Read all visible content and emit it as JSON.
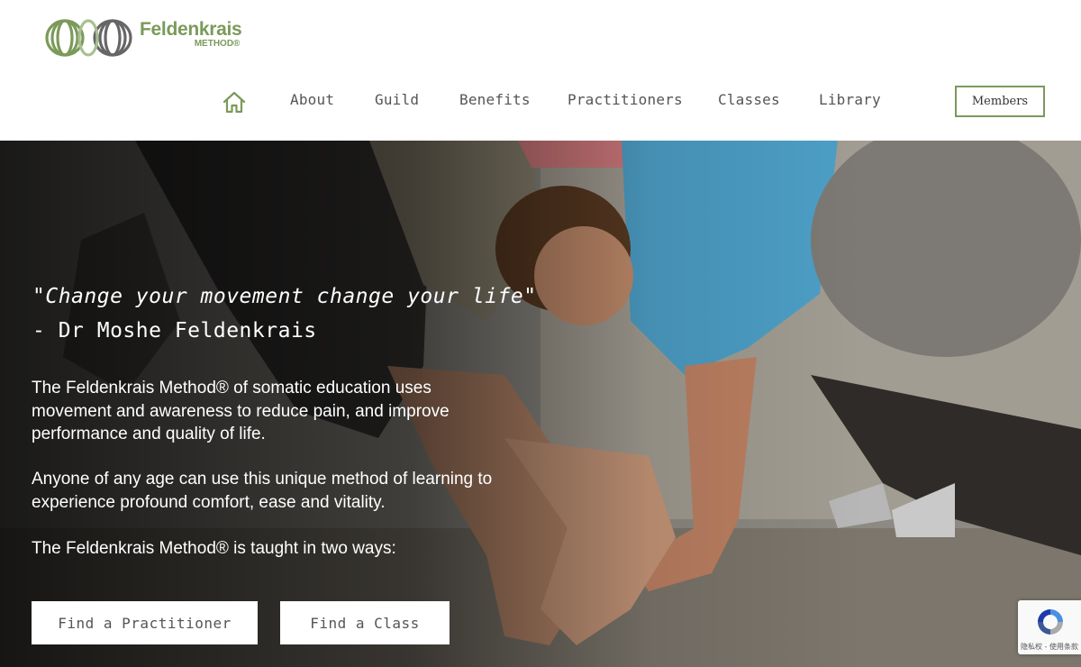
{
  "brand": {
    "name": "Feldenkrais",
    "sub": "METHOD®",
    "color": "#7a9a5a"
  },
  "nav": {
    "home_icon": "home-icon",
    "items": [
      "About",
      "Guild",
      "Benefits",
      "Practitioners",
      "Classes",
      "Library"
    ],
    "members_label": "Members"
  },
  "hero": {
    "quote": "\"Change your movement change your life\"",
    "author": "- Dr Moshe Feldenkrais",
    "paragraphs": [
      "The Feldenkrais Method® of somatic education uses movement and awareness to reduce pain, and improve performance and quality of life.",
      "Anyone of any age can use this unique method of learning to experience profound comfort, ease and vitality.",
      "The Feldenkrais Method® is taught in two ways:"
    ],
    "buttons": [
      "Find a Practitioner",
      "Find a Class"
    ]
  },
  "recaptcha": {
    "text": "隐私权 - 使用条款"
  }
}
